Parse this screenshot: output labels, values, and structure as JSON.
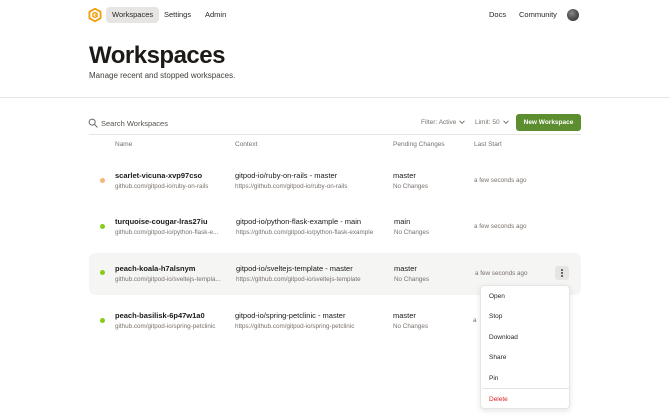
{
  "nav": {
    "links": [
      {
        "label": "Workspaces",
        "active": true
      },
      {
        "label": "Settings",
        "active": false
      },
      {
        "label": "Admin",
        "active": false
      }
    ],
    "right_links": [
      {
        "label": "Docs"
      },
      {
        "label": "Community"
      }
    ],
    "logo_color": "#f59e0b"
  },
  "header": {
    "title": "Workspaces",
    "subtitle": "Manage recent and stopped workspaces."
  },
  "toolbar": {
    "search_placeholder": "Search Workspaces",
    "filter_label": "Filter: Active",
    "limit_label": "Limit: 50",
    "new_button_label": "New Workspace",
    "accent_color": "#5c8d2f"
  },
  "table": {
    "columns": [
      "Name",
      "Context",
      "Pending Changes",
      "Last Start"
    ],
    "rows": [
      {
        "status": "stopped",
        "status_color": "#f3b77a",
        "name": "scarlet-vicuna-xvp97cso",
        "repo": "github.com/gitpod-io/ruby-on-rails",
        "context": "gitpod-io/ruby-on-rails - master",
        "context_url": "https://github.com/gitpod-io/ruby-on-rails",
        "branch": "master",
        "changes": "No Changes",
        "last_start": "a few seconds ago"
      },
      {
        "status": "running",
        "status_color": "#84cc16",
        "name": "turquoise-cougar-lras27iu",
        "repo": "github.com/gitpod-io/python-flask-e...",
        "context": "gitpod-io/python-flask-example - main",
        "context_url": "https://github.com/gitpod-io/python-flask-example",
        "branch": "main",
        "changes": "No Changes",
        "last_start": "a few seconds ago"
      },
      {
        "status": "running",
        "status_color": "#84cc16",
        "name": "peach-koala-h7alsnym",
        "repo": "github.com/gitpod-io/sveltejs-templa...",
        "context": "gitpod-io/sveltejs-template - master",
        "context_url": "https://github.com/gitpod-io/sveltejs-template",
        "branch": "master",
        "changes": "No Changes",
        "last_start": "a few seconds ago"
      },
      {
        "status": "running",
        "status_color": "#84cc16",
        "name": "peach-basilisk-6p47w1a0",
        "repo": "github.com/gitpod-io/spring-petclinic",
        "context": "gitpod-io/spring-petclinic - master",
        "context_url": "https://github.com/gitpod-io/spring-petclinic",
        "branch": "master",
        "changes": "No Changes",
        "last_start": "a"
      }
    ]
  },
  "context_menu": {
    "items": [
      {
        "label": "Open"
      },
      {
        "label": "Stop"
      },
      {
        "label": "Download"
      },
      {
        "label": "Share"
      },
      {
        "label": "Pin"
      },
      {
        "label": "Delete",
        "danger": true
      }
    ],
    "danger_color": "#dc2626"
  }
}
